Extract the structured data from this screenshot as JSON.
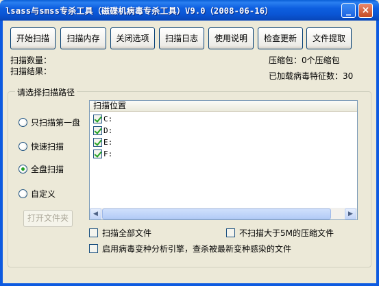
{
  "window": {
    "title": "lsass与smss专杀工具（磁碟机病毒专杀工具）V9.0（2008-06-16）",
    "min_glyph": "_",
    "close_glyph": "×"
  },
  "toolbar": {
    "buttons": [
      {
        "label": "开始扫描"
      },
      {
        "label": "扫描内存"
      },
      {
        "label": "关闭选项"
      },
      {
        "label": "扫描日志"
      },
      {
        "label": "使用说明"
      },
      {
        "label": "检查更新"
      },
      {
        "label": "文件提取"
      }
    ]
  },
  "status": {
    "scan_count": "扫描数量：",
    "scan_result": "扫描结果：",
    "compressed": "压缩包：0个压缩包",
    "signatures": "已加载病毒特征数：30"
  },
  "path_group": {
    "title": "请选择扫描路径",
    "options": [
      {
        "label": "只扫描第一盘",
        "checked": false
      },
      {
        "label": "快速扫描",
        "checked": false
      },
      {
        "label": "全盘扫描",
        "checked": true
      },
      {
        "label": "自定义",
        "checked": false
      }
    ],
    "open_folder": "打开文件夹"
  },
  "location_list": {
    "header": "扫描位置",
    "items": [
      {
        "label": "C:",
        "checked": true
      },
      {
        "label": "D:",
        "checked": true
      },
      {
        "label": "E:",
        "checked": true
      },
      {
        "label": "F:",
        "checked": true
      }
    ],
    "scroll_left": "◀",
    "scroll_right": "▶"
  },
  "options": {
    "scan_all_files": "扫描全部文件",
    "skip_large_archives": "不扫描大于5M的压缩文件",
    "variant_engine": "启用病毒变种分析引擎，查杀被最新变种感染的文件"
  },
  "colors": {
    "title_bar": "#0a55d4",
    "window_bg": "#ece9d8",
    "radio_dot": "#21a121"
  }
}
